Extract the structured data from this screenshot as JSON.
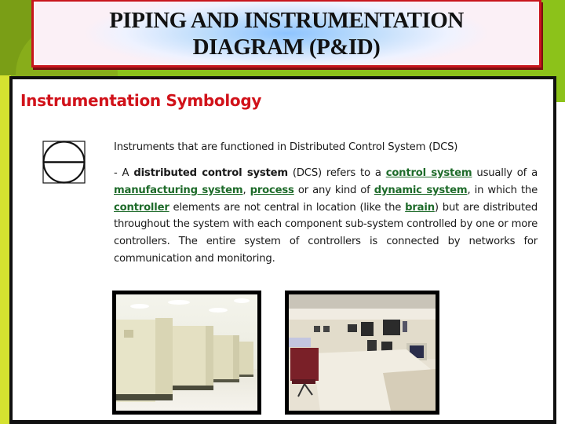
{
  "slide": {
    "title_lines": [
      "PIPING AND INSTRUMENTATION",
      "DIAGRAM (P&ID)"
    ],
    "section_heading": "Instrumentation Symbology",
    "symbol_icon": "dcs-instrument-symbol",
    "intro": "Instruments that are functioned in Distributed Control System (DCS)",
    "paragraph": {
      "prefix": "- A ",
      "bold_term": "distributed control system",
      "after_bold": " (DCS) refers to a ",
      "link_control_system": "control system",
      "text_1": " usually of a ",
      "link_manufacturing_system": "manufacturing system",
      "text_2": ", ",
      "link_process": "process",
      "text_3": " or any kind of ",
      "link_dynamic_system": "dynamic system",
      "text_4": ", in which the ",
      "link_controller": "controller",
      "text_5": " elements are not central in location (like the ",
      "link_brain": "brain",
      "text_6": ") but are distributed throughout the system with each component sub-system controlled by one or more controllers. The entire system of controllers is connected by networks for communication and monitoring."
    },
    "images": [
      {
        "name": "dcs-cabinets-photo",
        "description": "Rows of beige DCS control cabinets"
      },
      {
        "name": "control-room-photo",
        "description": "Control room console with monitors and chair"
      }
    ],
    "colors": {
      "background_green": "#8cc21a",
      "title_border_red": "#c8161d",
      "heading_red": "#d1121a",
      "link_green": "#1e6b2a"
    }
  }
}
